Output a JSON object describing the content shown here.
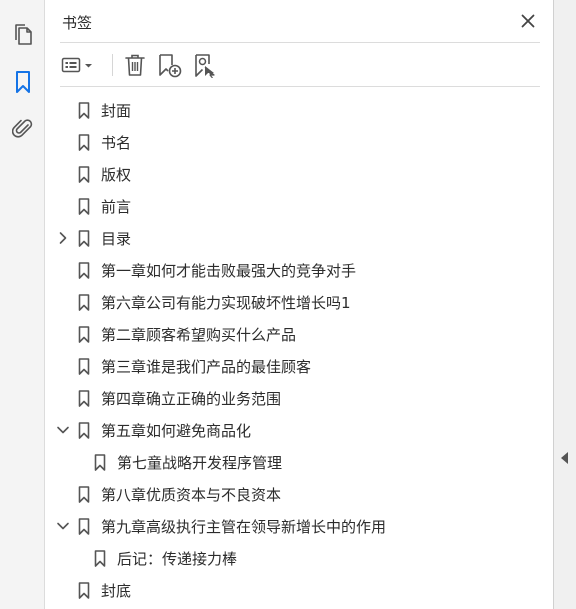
{
  "left_rail": {
    "items": [
      {
        "name": "pages-icon"
      },
      {
        "name": "bookmark-icon"
      },
      {
        "name": "attachment-icon"
      }
    ]
  },
  "panel": {
    "title": "书签",
    "close_icon": "close-icon",
    "toolbar": {
      "options_icon": "list-options-icon",
      "delete_icon": "trash-icon",
      "new_bookmark_icon": "new-bookmark-icon",
      "find_bookmark_icon": "find-current-bookmark-icon"
    }
  },
  "bookmarks": [
    {
      "label": "封面",
      "level": 0,
      "expander": "none"
    },
    {
      "label": "书名",
      "level": 0,
      "expander": "none"
    },
    {
      "label": "版权",
      "level": 0,
      "expander": "none"
    },
    {
      "label": "前言",
      "level": 0,
      "expander": "none"
    },
    {
      "label": "目录",
      "level": 0,
      "expander": "collapsed"
    },
    {
      "label": "第一章如何才能击败最强大的竞争对手",
      "level": 0,
      "expander": "none"
    },
    {
      "label": "第六章公司有能力实现破坏性增长吗1",
      "level": 0,
      "expander": "none"
    },
    {
      "label": "第二章顾客希望购买什么产品",
      "level": 0,
      "expander": "none"
    },
    {
      "label": "第三章谁是我们产品的最佳顾客",
      "level": 0,
      "expander": "none"
    },
    {
      "label": "第四章确立正确的业务范围",
      "level": 0,
      "expander": "none"
    },
    {
      "label": "第五章如何避免商品化",
      "level": 0,
      "expander": "expanded"
    },
    {
      "label": "第七童战略开发程序管理",
      "level": 1,
      "expander": "none"
    },
    {
      "label": "第八章优质资本与不良资本",
      "level": 0,
      "expander": "none"
    },
    {
      "label": "第九章高级执行主管在领导新增长中的作用",
      "level": 0,
      "expander": "expanded"
    },
    {
      "label": "后记：传递接力棒",
      "level": 1,
      "expander": "none"
    },
    {
      "label": "封底",
      "level": 0,
      "expander": "none"
    }
  ],
  "colors": {
    "accent": "#1473e6",
    "icon": "#555555",
    "text": "#2c2c2c"
  }
}
